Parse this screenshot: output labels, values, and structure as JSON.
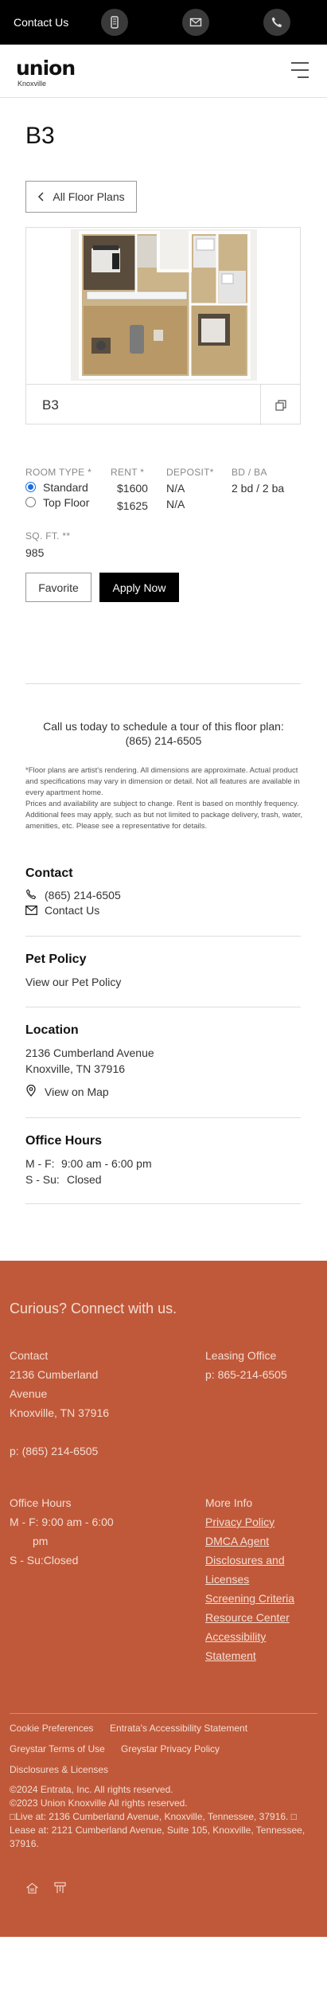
{
  "topbar": {
    "contact_label": "Contact Us"
  },
  "header": {
    "logo_word": "union",
    "logo_sub": "Knoxville"
  },
  "plan": {
    "title": "B3",
    "back_label": "All Floor Plans",
    "name": "B3",
    "room_type_label": "ROOM TYPE *",
    "room_types": [
      "Standard",
      "Top Floor"
    ],
    "rent_label": "RENT *",
    "rents": [
      "$1600",
      "$1625"
    ],
    "deposit_label": "DEPOSIT*",
    "deposits": [
      "N/A",
      "N/A"
    ],
    "bdba_label": "BD / BA",
    "bdba": "2 bd / 2 ba",
    "sqft_label": "SQ. FT. **",
    "sqft": "985",
    "favorite_label": "Favorite",
    "apply_label": "Apply Now"
  },
  "tour": {
    "line1": "Call us today to schedule a tour of this floor plan:",
    "phone": "(865) 214-6505"
  },
  "disclaimer": {
    "p1": "*Floor plans are artist's rendering. All dimensions are approximate. Actual product and specifications may vary in dimension or detail. Not all features are available in every apartment home.",
    "p2": "Prices and availability are subject to change. Rent is based on monthly frequency. Additional fees may apply, such as but not limited to package delivery, trash, water, amenities, etc. Please see a representative for details."
  },
  "contact": {
    "title": "Contact",
    "phone": "(865) 214-6505",
    "contact_us": "Contact Us"
  },
  "pet": {
    "title": "Pet Policy",
    "link": "View our Pet Policy"
  },
  "location": {
    "title": "Location",
    "line1": "2136 Cumberland Avenue",
    "line2": "Knoxville, TN 37916",
    "map_link": "View on Map"
  },
  "hours": {
    "title": "Office Hours",
    "mf_day": "M - F:",
    "mf_time": "9:00 am - 6:00 pm",
    "ss_day": "S - Su:",
    "ss_time": "Closed"
  },
  "footer": {
    "heading": "Curious? Connect with us.",
    "contact_label": "Contact",
    "addr1": "2136 Cumberland",
    "addr2": "Avenue",
    "addr3": "Knoxville, TN 37916",
    "phone": "p: (865) 214-6505",
    "leasing_label": "Leasing Office",
    "leasing_phone": "p: 865-214-6505",
    "hours_label": "Office Hours",
    "hours_mf": "M - F: 9:00 am - 6:00",
    "hours_mf2": "pm",
    "hours_ss": "S - Su:Closed",
    "more_info_label": "More Info",
    "links": [
      "Privacy Policy",
      "DMCA Agent",
      "Disclosures and",
      "Licenses",
      "Screening Criteria",
      "Resource Center",
      "Accessibility",
      "Statement"
    ],
    "bottom_links": [
      "Cookie Preferences",
      "Entrata's Accessibility Statement",
      "Greystar Terms of Use",
      "Greystar Privacy Policy",
      "Disclosures & Licenses"
    ],
    "copy1": "©2024 Entrata, Inc. All rights reserved.",
    "copy2": "©2023 Union Knoxville All rights reserved.",
    "copy3": "□Live at: 2136 Cumberland Avenue, Knoxville, Tennessee, 37916. □",
    "copy4": "Lease at: 2121 Cumberland Avenue, Suite 105, Knoxville, Tennessee,",
    "copy5": "37916."
  },
  "colors": {
    "footer_bg": "#c0593a",
    "primary": "#000000"
  }
}
